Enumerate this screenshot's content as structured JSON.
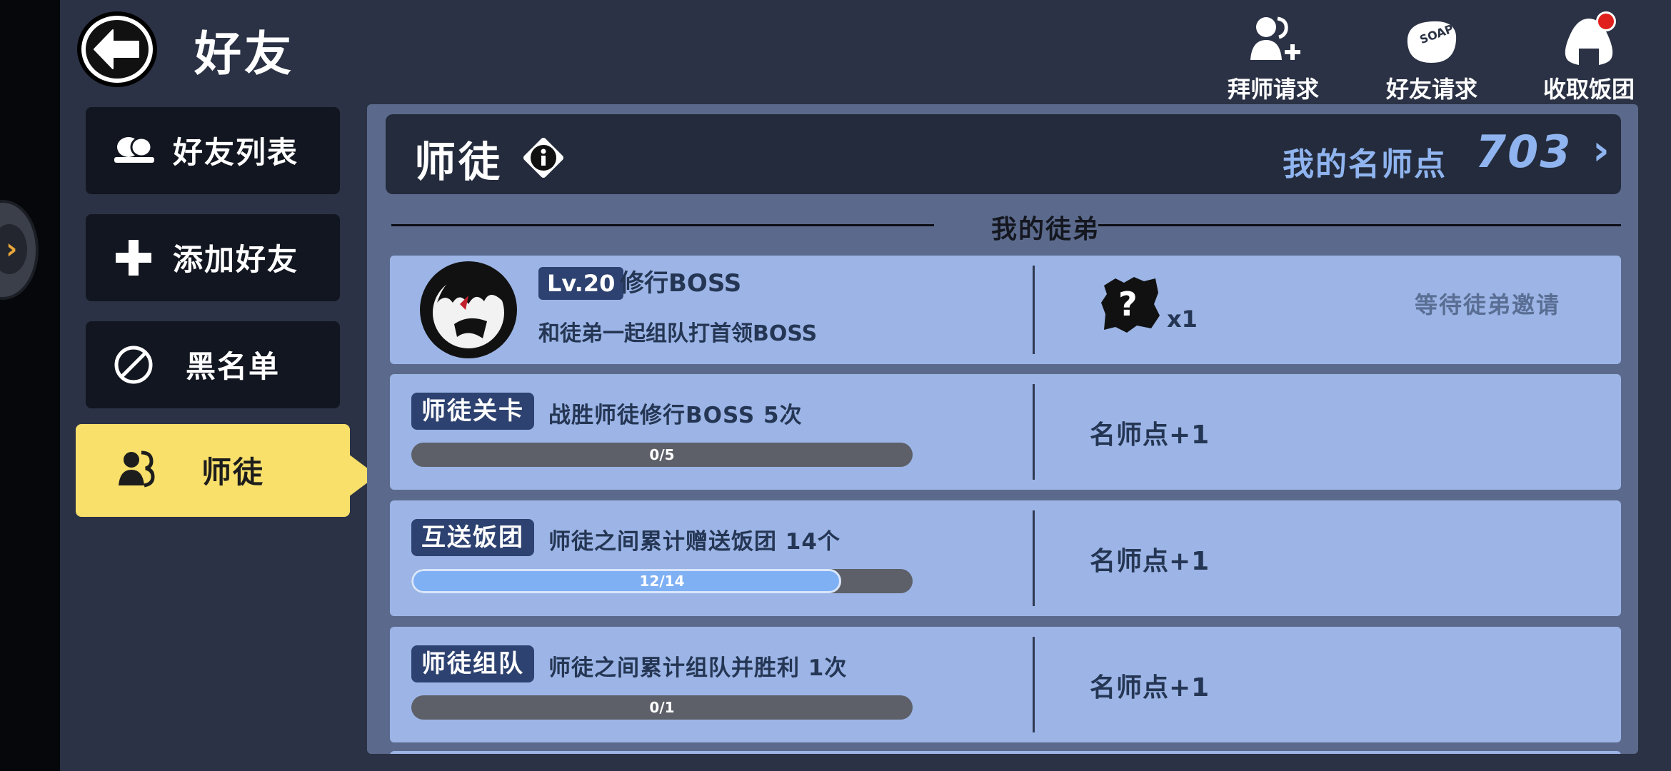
{
  "header": {
    "title": "好友",
    "actions": [
      {
        "label": "拜师请求",
        "icon": "add-mentor-icon"
      },
      {
        "label": "好友请求",
        "icon": "soap-icon"
      },
      {
        "label": "收取饭团",
        "icon": "rice-ball-icon",
        "has_notification": true
      }
    ]
  },
  "sidebar": {
    "items": [
      {
        "label": "好友列表",
        "icon": "friends-list-icon",
        "active": false
      },
      {
        "label": "添加好友",
        "icon": "plus-icon",
        "active": false
      },
      {
        "label": "黑名单",
        "icon": "blocked-icon",
        "active": false
      },
      {
        "label": "师徒",
        "icon": "mentor-icon",
        "active": true
      }
    ]
  },
  "panel": {
    "title": "师徒",
    "points_label": "我的名师点",
    "points_value": "703",
    "section_title": "我的徒弟",
    "boss": {
      "level": "Lv.20",
      "title": "修行BOSS",
      "desc": "和徒弟一起组队打首领BOSS",
      "reward_count": "x1",
      "status": "等待徒弟邀请"
    },
    "tasks": [
      {
        "badge": "师徒关卡",
        "desc": "战胜师徒修行BOSS 5次",
        "progress_text": "0/5",
        "progress": 0.0,
        "reward": "名师点+1"
      },
      {
        "badge": "互送饭团",
        "desc": "师徒之间累计赠送饭团 14个",
        "progress_text": "12/14",
        "progress": 0.857,
        "reward": "名师点+1"
      },
      {
        "badge": "师徒组队",
        "desc": "师徒之间累计组队并胜利 1次",
        "progress_text": "0/1",
        "progress": 0.0,
        "reward": "名师点+1"
      }
    ]
  },
  "colors": {
    "background": "#2b3245",
    "active_tab": "#f8e06a",
    "row_bg": "#9cb5e6",
    "badge_bg": "#2d4270",
    "points": "#8fb4ef",
    "progress_fill": "#7fb0f4",
    "notification": "#e0201c"
  }
}
